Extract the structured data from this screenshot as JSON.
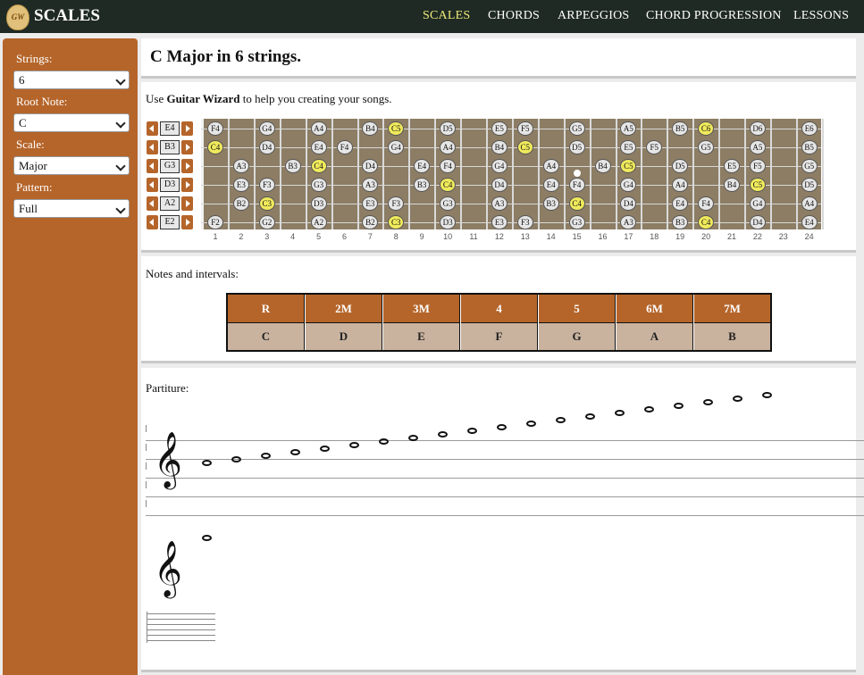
{
  "header": {
    "logo_text": "GW",
    "title": "SCALES",
    "nav": [
      "SCALES",
      "CHORDS",
      "ARPEGGIOS",
      "CHORD PROGRESSION",
      "LESSONS"
    ],
    "active_nav": "SCALES"
  },
  "sidebar": {
    "strings_label": "Strings:",
    "strings_value": "6",
    "root_label": "Root Note:",
    "root_value": "C",
    "scale_label": "Scale:",
    "scale_value": "Major",
    "pattern_label": "Pattern:",
    "pattern_value": "Full"
  },
  "main": {
    "page_title": "C Major in 6 strings.",
    "intro_prefix": "Use ",
    "intro_link": "Guitar Wizard",
    "intro_suffix": " to help you creating your songs.",
    "fretboard": {
      "tuning": [
        "E4",
        "B3",
        "G3",
        "D3",
        "A2",
        "E2"
      ],
      "fret_numbers": [
        "1",
        "2",
        "3",
        "4",
        "5",
        "6",
        "7",
        "8",
        "9",
        "10",
        "11",
        "12",
        "13",
        "14",
        "15",
        "16",
        "17",
        "18",
        "19",
        "20",
        "21",
        "22",
        "23",
        "24"
      ],
      "notes": [
        [
          [
            0,
            "F4"
          ],
          [
            2,
            "G4"
          ],
          [
            4,
            "A4"
          ],
          [
            6,
            "B4"
          ],
          [
            7,
            "C5"
          ],
          [
            9,
            "D5"
          ],
          [
            11,
            "E5"
          ],
          [
            12,
            "F5"
          ],
          [
            14,
            "G5"
          ],
          [
            16,
            "A5"
          ],
          [
            18,
            "B5"
          ],
          [
            19,
            "C6"
          ],
          [
            21,
            "D6"
          ],
          [
            23,
            "E6"
          ]
        ],
        [
          [
            0,
            "C4"
          ],
          [
            2,
            "D4"
          ],
          [
            4,
            "E4"
          ],
          [
            5,
            "F4"
          ],
          [
            7,
            "G4"
          ],
          [
            9,
            "A4"
          ],
          [
            11,
            "B4"
          ],
          [
            12,
            "C5"
          ],
          [
            14,
            "D5"
          ],
          [
            16,
            "E5"
          ],
          [
            17,
            "F5"
          ],
          [
            19,
            "G5"
          ],
          [
            21,
            "A5"
          ],
          [
            23,
            "B5"
          ]
        ],
        [
          [
            1,
            "A3"
          ],
          [
            3,
            "B3"
          ],
          [
            4,
            "C4"
          ],
          [
            6,
            "D4"
          ],
          [
            8,
            "E4"
          ],
          [
            9,
            "F4"
          ],
          [
            11,
            "G4"
          ],
          [
            13,
            "A4"
          ],
          [
            15,
            "B4"
          ],
          [
            16,
            "C5"
          ],
          [
            18,
            "D5"
          ],
          [
            20,
            "E5"
          ],
          [
            21,
            "F5"
          ],
          [
            23,
            "G5"
          ]
        ],
        [
          [
            1,
            "E3"
          ],
          [
            2,
            "F3"
          ],
          [
            4,
            "G3"
          ],
          [
            6,
            "A3"
          ],
          [
            8,
            "B3"
          ],
          [
            9,
            "C4"
          ],
          [
            11,
            "D4"
          ],
          [
            13,
            "E4"
          ],
          [
            14,
            "F4"
          ],
          [
            16,
            "G4"
          ],
          [
            18,
            "A4"
          ],
          [
            20,
            "B4"
          ],
          [
            21,
            "C5"
          ],
          [
            23,
            "D5"
          ]
        ],
        [
          [
            1,
            "B2"
          ],
          [
            2,
            "C3"
          ],
          [
            4,
            "D3"
          ],
          [
            6,
            "E3"
          ],
          [
            7,
            "F3"
          ],
          [
            9,
            "G3"
          ],
          [
            11,
            "A3"
          ],
          [
            13,
            "B3"
          ],
          [
            14,
            "C4"
          ],
          [
            16,
            "D4"
          ],
          [
            18,
            "E4"
          ],
          [
            19,
            "F4"
          ],
          [
            21,
            "G4"
          ],
          [
            23,
            "A4"
          ]
        ],
        [
          [
            0,
            "F2"
          ],
          [
            2,
            "G2"
          ],
          [
            4,
            "A2"
          ],
          [
            6,
            "B2"
          ],
          [
            7,
            "C3"
          ],
          [
            9,
            "D3"
          ],
          [
            11,
            "E3"
          ],
          [
            12,
            "F3"
          ],
          [
            14,
            "G3"
          ],
          [
            16,
            "A3"
          ],
          [
            18,
            "B3"
          ],
          [
            19,
            "C4"
          ],
          [
            21,
            "D4"
          ],
          [
            23,
            "E4"
          ]
        ]
      ],
      "marker_fret": 15,
      "root_color": "#f0ea5c"
    },
    "intervals_label": "Notes and intervals:",
    "intervals": [
      "R",
      "2M",
      "3M",
      "4",
      "5",
      "6M",
      "7M"
    ],
    "interval_notes": [
      "C",
      "D",
      "E",
      "F",
      "G",
      "A",
      "B"
    ],
    "partiture_label": "Partiture:",
    "clef_symbol": "𝄞"
  },
  "colors": {
    "accent": "#b5652a",
    "header_bg": "#1f2a24",
    "nav_active": "#f0ea7a",
    "fretboard_bg": "#8c7d64"
  }
}
